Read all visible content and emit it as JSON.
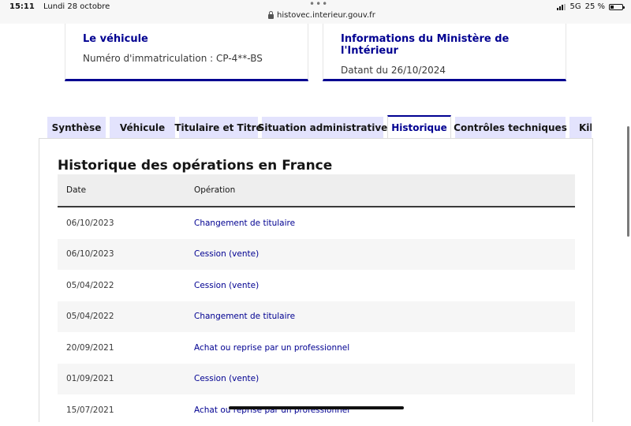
{
  "status_bar": {
    "time": "15:11",
    "date": "Lundi 28 octobre",
    "url": "histovec.interieur.gouv.fr",
    "network": "5G",
    "battery": "25 %",
    "battery_level": 0.25
  },
  "cards": [
    {
      "title": "Le véhicule",
      "text": "Numéro d'immatriculation : CP-4**-BS"
    },
    {
      "title": "Informations du Ministère de l'Intérieur",
      "text": "Datant du 26/10/2024"
    }
  ],
  "tabs": [
    {
      "label": "Synthèse",
      "active": false
    },
    {
      "label": "Véhicule",
      "active": false
    },
    {
      "label": "Titulaire et Titre",
      "active": false
    },
    {
      "label": "Situation administrative",
      "active": false
    },
    {
      "label": "Historique",
      "active": true
    },
    {
      "label": "Contrôles techniques",
      "active": false
    },
    {
      "label": "Kil",
      "active": false
    }
  ],
  "history": {
    "title": "Historique des opérations en France",
    "columns": [
      "Date",
      "Opération"
    ],
    "rows": [
      {
        "date": "06/10/2023",
        "operation": "Changement de titulaire"
      },
      {
        "date": "06/10/2023",
        "operation": "Cession (vente)"
      },
      {
        "date": "05/04/2022",
        "operation": "Cession (vente)"
      },
      {
        "date": "05/04/2022",
        "operation": "Changement de titulaire"
      },
      {
        "date": "20/09/2021",
        "operation": "Achat ou reprise par un professionnel"
      },
      {
        "date": "01/09/2021",
        "operation": "Cession (vente)"
      },
      {
        "date": "15/07/2021",
        "operation": "Achat ou reprise par un professionnel"
      }
    ]
  },
  "colors": {
    "accent": "#000091",
    "tab_bg": "#e3e3fd",
    "header_bg": "#eeeeee"
  }
}
